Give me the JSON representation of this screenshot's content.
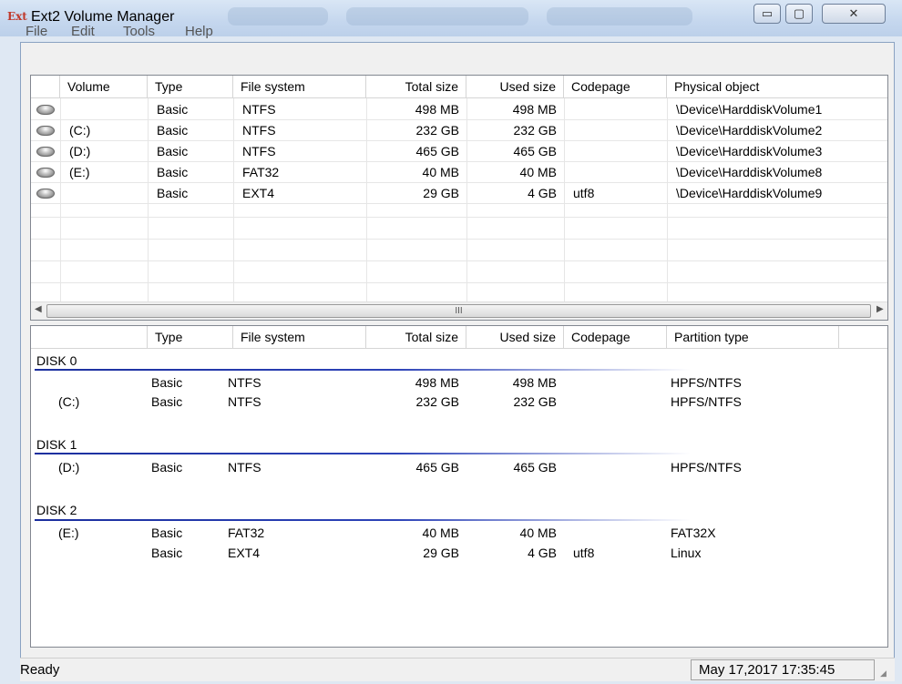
{
  "window": {
    "app_icon_text": "Ext",
    "title": "Ext2 Volume Manager",
    "minimize_glyph": "▭",
    "maximize_glyph": "▢",
    "close_glyph": "✕"
  },
  "menu": [
    "File",
    "Edit",
    "Tools",
    "Help"
  ],
  "volumes": {
    "columns": [
      "Volume",
      "Type",
      "File system",
      "Total size",
      "Used size",
      "Codepage",
      "Physical object"
    ],
    "rows": [
      {
        "volume": "",
        "type": "Basic",
        "fs": "NTFS",
        "total": "498 MB",
        "used": "498 MB",
        "codepage": "",
        "physical": "\\Device\\HarddiskVolume1"
      },
      {
        "volume": "(C:)",
        "type": "Basic",
        "fs": "NTFS",
        "total": "232 GB",
        "used": "232 GB",
        "codepage": "",
        "physical": "\\Device\\HarddiskVolume2"
      },
      {
        "volume": "(D:)",
        "type": "Basic",
        "fs": "NTFS",
        "total": "465 GB",
        "used": "465 GB",
        "codepage": "",
        "physical": "\\Device\\HarddiskVolume3"
      },
      {
        "volume": "(E:)",
        "type": "Basic",
        "fs": "FAT32",
        "total": "40 MB",
        "used": "40 MB",
        "codepage": "",
        "physical": "\\Device\\HarddiskVolume8"
      },
      {
        "volume": "",
        "type": "Basic",
        "fs": "EXT4",
        "total": "29 GB",
        "used": "4 GB",
        "codepage": "utf8",
        "physical": "\\Device\\HarddiskVolume9"
      }
    ],
    "scroll_thumb_glyph": "III"
  },
  "disks": {
    "columns": [
      "",
      "Type",
      "File system",
      "Total size",
      "Used size",
      "Codepage",
      "Partition type"
    ],
    "groups": [
      {
        "label": "DISK 0",
        "rows": [
          {
            "volume": "",
            "type": "Basic",
            "fs": "NTFS",
            "total": "498 MB",
            "used": "498 MB",
            "codepage": "",
            "ptype": "HPFS/NTFS"
          },
          {
            "volume": "(C:)",
            "type": "Basic",
            "fs": "NTFS",
            "total": "232 GB",
            "used": "232 GB",
            "codepage": "",
            "ptype": "HPFS/NTFS"
          }
        ]
      },
      {
        "label": "DISK 1",
        "rows": [
          {
            "volume": "(D:)",
            "type": "Basic",
            "fs": "NTFS",
            "total": "465 GB",
            "used": "465 GB",
            "codepage": "",
            "ptype": "HPFS/NTFS"
          }
        ]
      },
      {
        "label": "DISK 2",
        "rows": [
          {
            "volume": "(E:)",
            "type": "Basic",
            "fs": "FAT32",
            "total": "40 MB",
            "used": "40 MB",
            "codepage": "",
            "ptype": "FAT32X"
          },
          {
            "volume": "",
            "type": "Basic",
            "fs": "EXT4",
            "total": "29 GB",
            "used": "4 GB",
            "codepage": "utf8",
            "ptype": "Linux"
          }
        ]
      }
    ]
  },
  "status": {
    "left": "Ready",
    "right": "May 17,2017 17:35:45"
  }
}
